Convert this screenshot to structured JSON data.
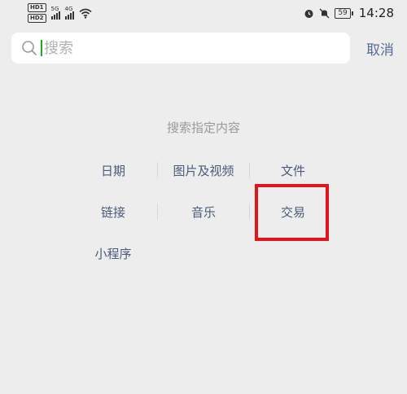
{
  "status_bar": {
    "hd_badges": [
      "HD1",
      "HD2"
    ],
    "net_1": "5G",
    "net_2": "4G",
    "battery": "59",
    "time": "14:28"
  },
  "search": {
    "placeholder": "搜索",
    "value": "",
    "cancel_label": "取消"
  },
  "main": {
    "hint": "搜索指定内容",
    "categories": [
      {
        "label": "日期"
      },
      {
        "label": "图片及视频"
      },
      {
        "label": "文件"
      },
      {
        "label": "链接"
      },
      {
        "label": "音乐"
      },
      {
        "label": "交易"
      },
      {
        "label": "小程序"
      }
    ],
    "highlight_color": "#e0161c",
    "accent_color": "#576b95"
  }
}
